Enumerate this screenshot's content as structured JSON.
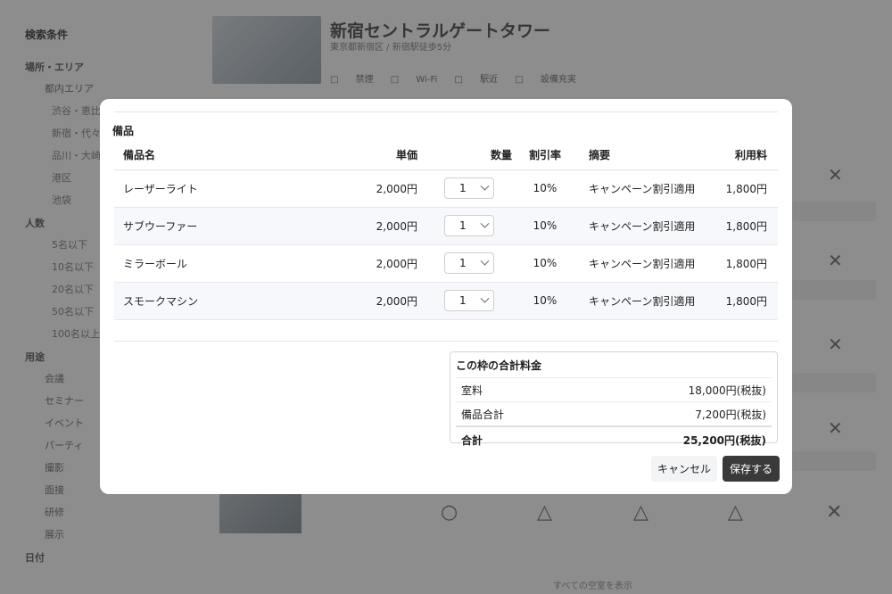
{
  "background": {
    "sidebar_title": "検索条件",
    "sidebar_section1": "場所・エリア",
    "sidebar_items1": [
      "都内エリア",
      "渋谷・恵比寿",
      "新宿・代々木",
      "品川・大崎",
      "港区",
      "池袋"
    ],
    "sidebar_section2": "人数",
    "sidebar_items2": [
      "5名以下",
      "10名以下",
      "20名以下",
      "50名以下",
      "100名以上"
    ],
    "sidebar_section3": "用途",
    "sidebar_items3": [
      "会議",
      "セミナー",
      "イベント",
      "パーティ",
      "撮影",
      "面接",
      "研修",
      "展示"
    ],
    "sidebar_section4": "日付",
    "property_title": "新宿セントラルゲートタワー",
    "property_sub": "東京都新宿区 / 新宿駅徒歩5分",
    "property_tags": "□ 禁煙  □ Wi-Fi  □ 駅近  □ 設備充実",
    "footer_note": "すべての空室を表示"
  },
  "modal": {
    "section_title": "備品",
    "table": {
      "headers": {
        "name": "備品名",
        "price": "単価",
        "qty": "数量",
        "rate": "割引率",
        "note": "摘要",
        "fee": "利用料"
      },
      "rows": [
        {
          "name": "レーザーライト",
          "price": "2,000円",
          "qty": "1",
          "rate": "10%",
          "note": "キャンペーン割引適用",
          "fee": "1,800円"
        },
        {
          "name": "サブウーファー",
          "price": "2,000円",
          "qty": "1",
          "rate": "10%",
          "note": "キャンペーン割引適用",
          "fee": "1,800円"
        },
        {
          "name": "ミラーボール",
          "price": "2,000円",
          "qty": "1",
          "rate": "10%",
          "note": "キャンペーン割引適用",
          "fee": "1,800円"
        },
        {
          "name": "スモークマシン",
          "price": "2,000円",
          "qty": "1",
          "rate": "10%",
          "note": "キャンペーン割引適用",
          "fee": "1,800円"
        }
      ]
    },
    "summary": {
      "title": "この枠の合計料金",
      "room_label": "室料",
      "room_value": "18,000円(税抜)",
      "equip_label": "備品合計",
      "equip_value": "7,200円(税抜)",
      "total_label": "合計",
      "total_value": "25,200円(税抜)"
    },
    "buttons": {
      "cancel": "キャンセル",
      "save": "保存する"
    }
  }
}
